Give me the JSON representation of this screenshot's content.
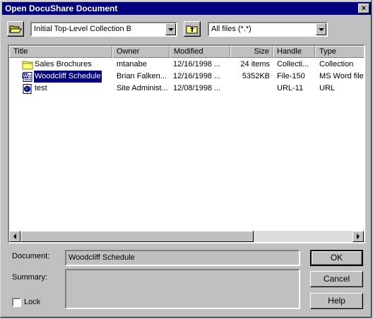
{
  "window": {
    "title": "Open DocuShare Document",
    "close_glyph": "×"
  },
  "toolbar": {
    "collection_value": "Initial Top-Level Collection B",
    "filter_value": "All files (*.*)"
  },
  "columns": [
    "Title",
    "Owner",
    "Modified",
    "Size",
    "Handle",
    "Type"
  ],
  "rows": [
    {
      "title": "Sales Brochures",
      "owner": "mtanabe",
      "modified": "12/16/1998 ...",
      "size": "24 items",
      "handle": "Collecti...",
      "type": "Collection",
      "icon": "folder-icon"
    },
    {
      "title": "Woodcliff Schedule",
      "owner": "Brian Falken...",
      "modified": "12/16/1998 ...",
      "size": "5352KB",
      "handle": "File-150",
      "type": "MS Word file",
      "icon": "word-document-icon",
      "selected": true
    },
    {
      "title": "test",
      "owner": "Site Administ...",
      "modified": "12/08/1998 ...",
      "size": "",
      "handle": "URL-11",
      "type": "URL",
      "icon": "url-globe-icon"
    }
  ],
  "form": {
    "document_label": "Document:",
    "document_value": "Woodcliff Schedule",
    "summary_label": "Summary:",
    "summary_value": "",
    "lock_label": "Lock"
  },
  "buttons": {
    "ok": "OK",
    "cancel": "Cancel",
    "help": "Help"
  }
}
